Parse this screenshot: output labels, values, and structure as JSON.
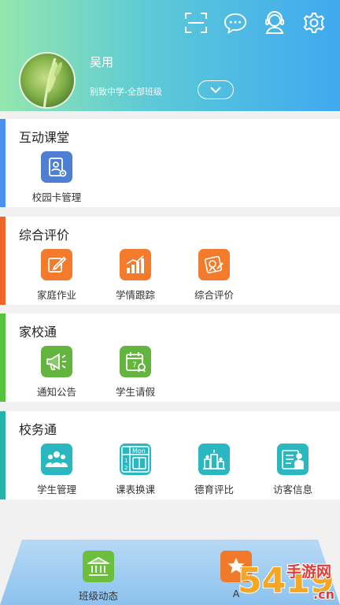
{
  "profile": {
    "name": "吴用",
    "school": "别致中学-全部班级"
  },
  "sections": [
    {
      "title": "互动课堂",
      "accent": "#4a90f0",
      "items": [
        {
          "label": "校园卡管理",
          "icon": "school-card-icon",
          "color": "#4f7fd3"
        }
      ]
    },
    {
      "title": "综合评价",
      "accent": "#f0652a",
      "items": [
        {
          "label": "家庭作业",
          "icon": "homework-icon",
          "color": "#f37b2b"
        },
        {
          "label": "学情跟踪",
          "icon": "tracking-chart-icon",
          "color": "#f37b2b"
        },
        {
          "label": "综合评价",
          "icon": "evaluation-icon",
          "color": "#f37b2b"
        }
      ]
    },
    {
      "title": "家校通",
      "accent": "#55c43a",
      "items": [
        {
          "label": "通知公告",
          "icon": "megaphone-icon",
          "color": "#63b53f"
        },
        {
          "label": "学生请假",
          "icon": "calendar-leave-icon",
          "color": "#63b53f"
        }
      ]
    },
    {
      "title": "校务通",
      "accent": "#26b4a9",
      "items": [
        {
          "label": "学生管理",
          "icon": "students-icon",
          "color": "#2ab7c0"
        },
        {
          "label": "课表换课",
          "icon": "timetable-icon",
          "color": "#2ab7c0"
        },
        {
          "label": "德育评比",
          "icon": "ranking-icon",
          "color": "#2ab7c0"
        },
        {
          "label": "访客信息",
          "icon": "visitor-icon",
          "color": "#2ab7c0"
        }
      ]
    }
  ],
  "timetable_icon_text": "Mon",
  "calendar_icon_text": "7",
  "bottom_nav": [
    {
      "label": "班级动态",
      "icon": "class-news-icon",
      "color": "#6bbf3d"
    },
    {
      "label": "A",
      "icon": "star-badge-icon",
      "color": "#f07a2a"
    }
  ],
  "watermark": {
    "digits": "5419",
    "text": "手游网",
    "domain": ".cn"
  }
}
